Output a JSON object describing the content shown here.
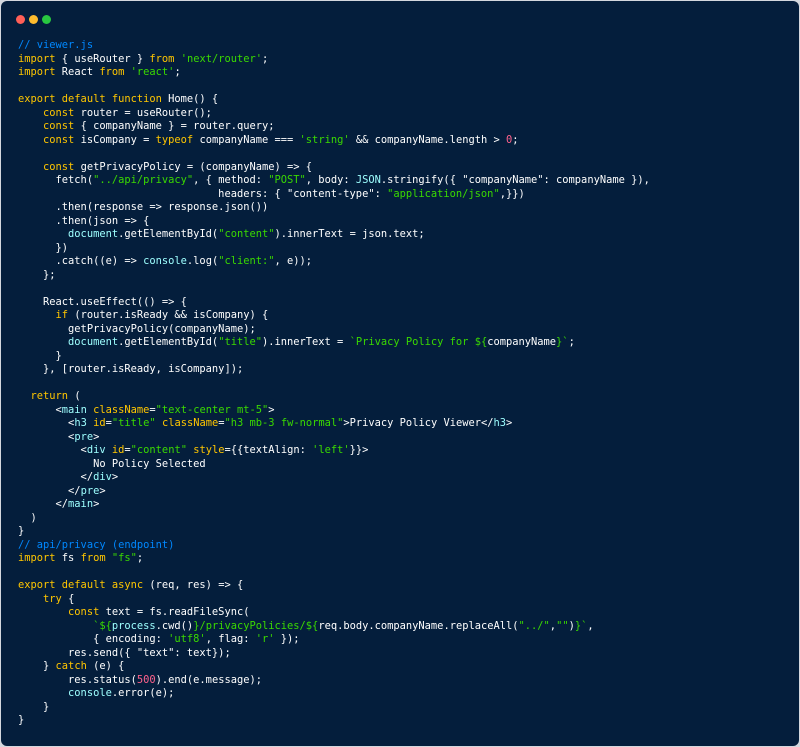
{
  "window": {
    "controls": [
      {
        "name": "close",
        "color": "#ff5f57"
      },
      {
        "name": "minimize",
        "color": "#febc2e"
      },
      {
        "name": "maximize",
        "color": "#28c840"
      }
    ]
  },
  "code": {
    "language": "javascript",
    "lines": [
      [
        {
          "t": "// viewer.js",
          "c": "comment"
        }
      ],
      [
        {
          "t": "import",
          "c": "keyword"
        },
        {
          "t": " { useRouter } ",
          "c": "plain"
        },
        {
          "t": "from",
          "c": "keyword"
        },
        {
          "t": " ",
          "c": "plain"
        },
        {
          "t": "'next/router'",
          "c": "string"
        },
        {
          "t": ";",
          "c": "plain"
        }
      ],
      [
        {
          "t": "import",
          "c": "keyword"
        },
        {
          "t": " React ",
          "c": "plain"
        },
        {
          "t": "from",
          "c": "keyword"
        },
        {
          "t": " ",
          "c": "plain"
        },
        {
          "t": "'react'",
          "c": "string"
        },
        {
          "t": ";",
          "c": "plain"
        }
      ],
      [],
      [
        {
          "t": "export default function",
          "c": "keyword"
        },
        {
          "t": " Home() {",
          "c": "plain"
        }
      ],
      [
        {
          "t": "    ",
          "c": "plain"
        },
        {
          "t": "const",
          "c": "keyword"
        },
        {
          "t": " router = useRouter();",
          "c": "plain"
        }
      ],
      [
        {
          "t": "    ",
          "c": "plain"
        },
        {
          "t": "const",
          "c": "keyword"
        },
        {
          "t": " { companyName } = router.query;",
          "c": "plain"
        }
      ],
      [
        {
          "t": "    ",
          "c": "plain"
        },
        {
          "t": "const",
          "c": "keyword"
        },
        {
          "t": " isCompany = ",
          "c": "plain"
        },
        {
          "t": "typeof",
          "c": "keyword"
        },
        {
          "t": " companyName === ",
          "c": "plain"
        },
        {
          "t": "'string'",
          "c": "string"
        },
        {
          "t": " && companyName.length > ",
          "c": "plain"
        },
        {
          "t": "0",
          "c": "number"
        },
        {
          "t": ";",
          "c": "plain"
        }
      ],
      [],
      [
        {
          "t": "    ",
          "c": "plain"
        },
        {
          "t": "const",
          "c": "keyword"
        },
        {
          "t": " getPrivacyPolicy = (companyName) => {",
          "c": "plain"
        }
      ],
      [
        {
          "t": "      fetch(",
          "c": "plain"
        },
        {
          "t": "\"../api/privacy\"",
          "c": "string"
        },
        {
          "t": ", { method: ",
          "c": "plain"
        },
        {
          "t": "\"POST\"",
          "c": "string"
        },
        {
          "t": ", body: ",
          "c": "plain"
        },
        {
          "t": "JSON",
          "c": "builtin"
        },
        {
          "t": ".stringify({ \"companyName\": companyName }),",
          "c": "plain"
        }
      ],
      [
        {
          "t": "                                headers: { \"content-type\": ",
          "c": "plain"
        },
        {
          "t": "\"application/json\"",
          "c": "string"
        },
        {
          "t": ",}})",
          "c": "plain"
        }
      ],
      [
        {
          "t": "      .then(response => response.json())",
          "c": "plain"
        }
      ],
      [
        {
          "t": "      .then(json => {",
          "c": "plain"
        }
      ],
      [
        {
          "t": "        ",
          "c": "plain"
        },
        {
          "t": "document",
          "c": "builtin"
        },
        {
          "t": ".getElementById(",
          "c": "plain"
        },
        {
          "t": "\"content\"",
          "c": "string"
        },
        {
          "t": ").innerText = json.text;",
          "c": "plain"
        }
      ],
      [
        {
          "t": "      })",
          "c": "plain"
        }
      ],
      [
        {
          "t": "      .catch((e) => ",
          "c": "plain"
        },
        {
          "t": "console",
          "c": "builtin"
        },
        {
          "t": ".log(",
          "c": "plain"
        },
        {
          "t": "\"client:\"",
          "c": "string"
        },
        {
          "t": ", e));",
          "c": "plain"
        }
      ],
      [
        {
          "t": "    };",
          "c": "plain"
        }
      ],
      [],
      [
        {
          "t": "    React.useEffect(() => {",
          "c": "plain"
        }
      ],
      [
        {
          "t": "      ",
          "c": "plain"
        },
        {
          "t": "if",
          "c": "keyword"
        },
        {
          "t": " (router.isReady && isCompany) {",
          "c": "plain"
        }
      ],
      [
        {
          "t": "        getPrivacyPolicy(companyName);",
          "c": "plain"
        }
      ],
      [
        {
          "t": "        ",
          "c": "plain"
        },
        {
          "t": "document",
          "c": "builtin"
        },
        {
          "t": ".getElementById(",
          "c": "plain"
        },
        {
          "t": "\"title\"",
          "c": "string"
        },
        {
          "t": ").innerText = ",
          "c": "plain"
        },
        {
          "t": "`Privacy Policy for ${",
          "c": "string"
        },
        {
          "t": "companyName",
          "c": "plain"
        },
        {
          "t": "}`",
          "c": "string"
        },
        {
          "t": ";",
          "c": "plain"
        }
      ],
      [
        {
          "t": "      }",
          "c": "plain"
        }
      ],
      [
        {
          "t": "    }, [router.isReady, isCompany]);",
          "c": "plain"
        }
      ],
      [],
      [
        {
          "t": "  ",
          "c": "plain"
        },
        {
          "t": "return",
          "c": "keyword"
        },
        {
          "t": " (",
          "c": "plain"
        }
      ],
      [
        {
          "t": "      <",
          "c": "plain"
        },
        {
          "t": "main",
          "c": "tag"
        },
        {
          "t": " ",
          "c": "plain"
        },
        {
          "t": "className",
          "c": "attr"
        },
        {
          "t": "=",
          "c": "plain"
        },
        {
          "t": "\"text-center mt-5\"",
          "c": "string"
        },
        {
          "t": ">",
          "c": "plain"
        }
      ],
      [
        {
          "t": "        <",
          "c": "plain"
        },
        {
          "t": "h3",
          "c": "tag"
        },
        {
          "t": " ",
          "c": "plain"
        },
        {
          "t": "id",
          "c": "attr"
        },
        {
          "t": "=",
          "c": "plain"
        },
        {
          "t": "\"title\"",
          "c": "string"
        },
        {
          "t": " ",
          "c": "plain"
        },
        {
          "t": "className",
          "c": "attr"
        },
        {
          "t": "=",
          "c": "plain"
        },
        {
          "t": "\"h3 mb-3 fw-normal\"",
          "c": "string"
        },
        {
          "t": ">Privacy Policy Viewer</",
          "c": "plain"
        },
        {
          "t": "h3",
          "c": "tag"
        },
        {
          "t": ">",
          "c": "plain"
        }
      ],
      [
        {
          "t": "        <",
          "c": "plain"
        },
        {
          "t": "pre",
          "c": "tag"
        },
        {
          "t": ">",
          "c": "plain"
        }
      ],
      [
        {
          "t": "          <",
          "c": "plain"
        },
        {
          "t": "div",
          "c": "tag"
        },
        {
          "t": " ",
          "c": "plain"
        },
        {
          "t": "id",
          "c": "attr"
        },
        {
          "t": "=",
          "c": "plain"
        },
        {
          "t": "\"content\"",
          "c": "string"
        },
        {
          "t": " ",
          "c": "plain"
        },
        {
          "t": "style",
          "c": "attr"
        },
        {
          "t": "={{textAlign: ",
          "c": "plain"
        },
        {
          "t": "'left'",
          "c": "string"
        },
        {
          "t": "}}>",
          "c": "plain"
        }
      ],
      [
        {
          "t": "            No Policy Selected",
          "c": "plain"
        }
      ],
      [
        {
          "t": "          </",
          "c": "plain"
        },
        {
          "t": "div",
          "c": "tag"
        },
        {
          "t": ">",
          "c": "plain"
        }
      ],
      [
        {
          "t": "        </",
          "c": "plain"
        },
        {
          "t": "pre",
          "c": "tag"
        },
        {
          "t": ">",
          "c": "plain"
        }
      ],
      [
        {
          "t": "      </",
          "c": "plain"
        },
        {
          "t": "main",
          "c": "tag"
        },
        {
          "t": ">",
          "c": "plain"
        }
      ],
      [
        {
          "t": "  )",
          "c": "plain"
        }
      ],
      [
        {
          "t": "}",
          "c": "plain"
        }
      ],
      [
        {
          "t": "// api/privacy (endpoint)",
          "c": "comment"
        }
      ],
      [
        {
          "t": "import",
          "c": "keyword"
        },
        {
          "t": " fs ",
          "c": "plain"
        },
        {
          "t": "from",
          "c": "keyword"
        },
        {
          "t": " ",
          "c": "plain"
        },
        {
          "t": "\"fs\"",
          "c": "string"
        },
        {
          "t": ";",
          "c": "plain"
        }
      ],
      [],
      [
        {
          "t": "export default async",
          "c": "keyword"
        },
        {
          "t": " (req, res) => {",
          "c": "plain"
        }
      ],
      [
        {
          "t": "    ",
          "c": "plain"
        },
        {
          "t": "try",
          "c": "keyword"
        },
        {
          "t": " {",
          "c": "plain"
        }
      ],
      [
        {
          "t": "        ",
          "c": "plain"
        },
        {
          "t": "const",
          "c": "keyword"
        },
        {
          "t": " text = fs.readFileSync(",
          "c": "plain"
        }
      ],
      [
        {
          "t": "            ",
          "c": "plain"
        },
        {
          "t": "`${",
          "c": "string"
        },
        {
          "t": "process",
          "c": "builtin"
        },
        {
          "t": ".cwd()",
          "c": "plain"
        },
        {
          "t": "}/privacyPolicies/${",
          "c": "string"
        },
        {
          "t": "req.body.companyName.replaceAll(",
          "c": "plain"
        },
        {
          "t": "\"../\"",
          "c": "string"
        },
        {
          "t": ",",
          "c": "plain"
        },
        {
          "t": "\"\"",
          "c": "string"
        },
        {
          "t": ")",
          "c": "plain"
        },
        {
          "t": "}`",
          "c": "string"
        },
        {
          "t": ",",
          "c": "plain"
        }
      ],
      [
        {
          "t": "            { encoding: ",
          "c": "plain"
        },
        {
          "t": "'utf8'",
          "c": "string"
        },
        {
          "t": ", flag: ",
          "c": "plain"
        },
        {
          "t": "'r'",
          "c": "string"
        },
        {
          "t": " });",
          "c": "plain"
        }
      ],
      [
        {
          "t": "        res.send({ \"text\": text});",
          "c": "plain"
        }
      ],
      [
        {
          "t": "    } ",
          "c": "plain"
        },
        {
          "t": "catch",
          "c": "keyword"
        },
        {
          "t": " (e) {",
          "c": "plain"
        }
      ],
      [
        {
          "t": "        res.status(",
          "c": "plain"
        },
        {
          "t": "500",
          "c": "number"
        },
        {
          "t": ").end(e.message);",
          "c": "plain"
        }
      ],
      [
        {
          "t": "        ",
          "c": "plain"
        },
        {
          "t": "console",
          "c": "builtin"
        },
        {
          "t": ".error(e);",
          "c": "plain"
        }
      ],
      [
        {
          "t": "    }",
          "c": "plain"
        }
      ],
      [
        {
          "t": "}",
          "c": "plain"
        }
      ]
    ]
  }
}
